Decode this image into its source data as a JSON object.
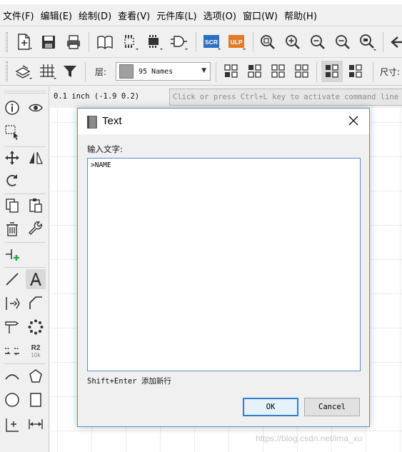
{
  "menubar": {
    "items": [
      "文件(F)",
      "编辑(E)",
      "绘制(D)",
      "查看(V)",
      "元件库(L)",
      "选项(O)",
      "窗口(W)",
      "帮助(H)"
    ]
  },
  "toolbar1": {
    "icons": [
      "new-file-icon",
      "save-icon",
      "print-icon",
      "library-book-icon",
      "board-icon",
      "chip-icon",
      "gate-icon",
      "scr-icon",
      "ulp-icon",
      "zoom-fit-icon",
      "zoom-in-icon",
      "zoom-out-icon",
      "zoom-select-icon",
      "zoom-last-icon",
      "back-arrow-icon"
    ],
    "scr_label": "SCR",
    "ulp_label": "ULP"
  },
  "toolbar2": {
    "layer_label": "层:",
    "layer_value": "95 Names",
    "size_label": "尺寸:"
  },
  "coord": "0.1 inch (-1.9 0.2)",
  "command_placeholder": "Click or press Ctrl+L key to activate command line mode",
  "dialog": {
    "title": "Text",
    "prompt": "输入文字:",
    "value": ">NAME",
    "hint": "Shift+Enter 添加新行",
    "ok_label": "OK",
    "cancel_label": "Cancel"
  },
  "lefttools": {
    "icons": [
      "info-icon",
      "eye-icon",
      "group-select-icon",
      "move-icon",
      "mirror-icon",
      "rotate-icon",
      "copy-icon",
      "paste-icon",
      "delete-icon",
      "wrench-icon",
      "add-part-icon",
      "line-icon",
      "text-icon",
      "pin-icon",
      "miter-icon",
      "split-icon",
      "smash-icon",
      "net-icon",
      "name-value-icon",
      "arc-icon",
      "polygon-icon",
      "circle-icon",
      "rectangle-icon",
      "origin-icon",
      "dimension-icon"
    ],
    "r2_label": "R2",
    "r2_sub": "10k"
  },
  "colors": {
    "accent": "#5b8ec9",
    "scr": "#2e6fc1",
    "ulp": "#e07b2a",
    "add": "#2fa84f"
  },
  "watermark": "https://blog.csdn.net/ima_xu"
}
